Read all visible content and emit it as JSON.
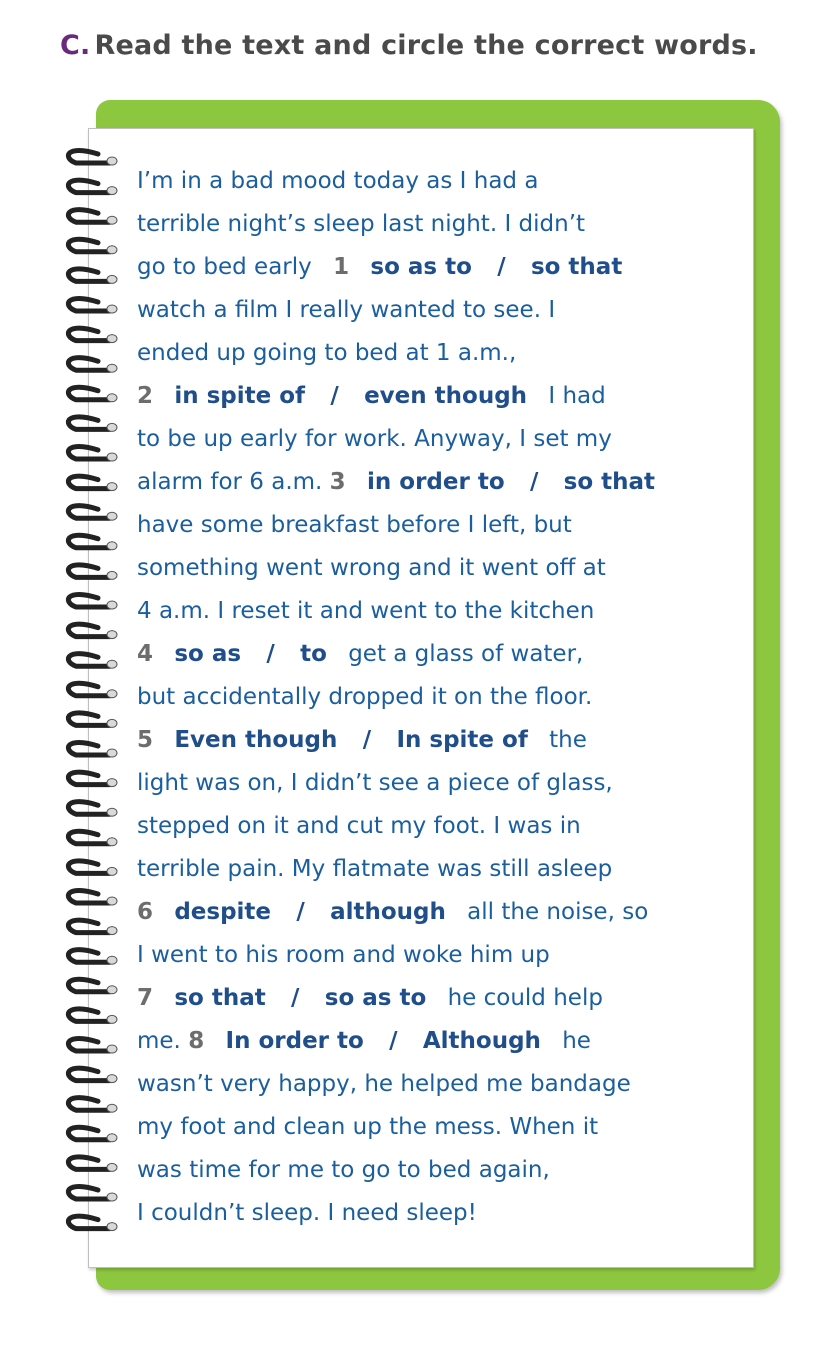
{
  "header": {
    "letter": "C.",
    "instruction": "Read the text and circle the correct words."
  },
  "text": {
    "l1": "I’m in a bad mood today as I had a",
    "l2": "terrible night’s sleep last night. I didn’t",
    "l3_pre": "go to bed early",
    "q1": {
      "num": "1",
      "a": "so as to",
      "sep": "/",
      "b": "so that"
    },
    "l4": "watch a film I really wanted to see. I",
    "l5": "ended up going to bed at 1 a.m.,",
    "q2": {
      "num": "2",
      "a": "in spite of",
      "sep": "/",
      "b": "even though",
      "post": "I had"
    },
    "l7": "to be up early for work. Anyway, I set my",
    "l8_pre": "alarm for 6 a.m.",
    "q3": {
      "num": "3",
      "a": "in order to",
      "sep": "/",
      "b": "so that"
    },
    "l9": "have some breakfast before I left, but",
    "l10": "something went wrong and it went off at",
    "l11": "4 a.m. I reset it and went to the kitchen",
    "q4": {
      "num": "4",
      "a": "so as",
      "sep": "/",
      "b": "to",
      "post": "get a glass of water,"
    },
    "l13": "but accidentally dropped it on the floor.",
    "q5": {
      "num": "5",
      "a": "Even though",
      "sep": "/",
      "b": "In spite of",
      "post": "the"
    },
    "l15": "light was on, I didn’t see a piece of glass,",
    "l16": "stepped on it and cut my foot. I was in",
    "l17": "terrible pain. My flatmate was still asleep",
    "q6": {
      "num": "6",
      "a": "despite",
      "sep": "/",
      "b": "although",
      "post": "all the noise, so"
    },
    "l19": "I went to his room and woke him up",
    "q7": {
      "num": "7",
      "a": "so that",
      "sep": "/",
      "b": "so as to",
      "post": "he could help"
    },
    "l21_pre": "me.",
    "q8": {
      "num": "8",
      "a": "In order to",
      "sep": "/",
      "b": "Although",
      "post": "he"
    },
    "l22": "wasn’t very happy, he helped me bandage",
    "l23": "my foot and clean up the mess. When it",
    "l24": "was time for me to go to bed again,",
    "l25": "I couldn’t sleep. I need sleep!"
  },
  "colors": {
    "accent_green": "#8dc63f",
    "text_blue": "#1b5e9e",
    "option_blue": "#1f4e8a",
    "number_gray": "#6d6d6d",
    "letter_purple": "#6a2a7c"
  }
}
